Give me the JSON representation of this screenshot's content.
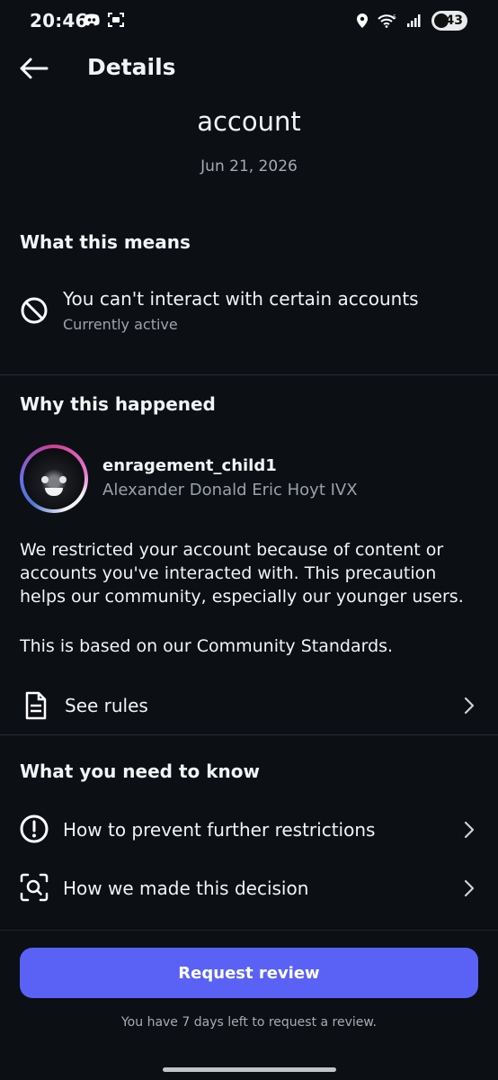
{
  "status_bar": {
    "time": "20:46",
    "battery_level": "43",
    "icons_left": [
      "discord-icon",
      "screenshot-icon"
    ],
    "icons_right": [
      "location-icon",
      "wifi-icon",
      "signal-icon",
      "battery-icon"
    ]
  },
  "header": {
    "title": "Details",
    "back_icon": "arrow-left-icon"
  },
  "hero": {
    "title_visible": "account",
    "date": "Jun 21, 2026"
  },
  "sections": {
    "what_this_means": {
      "heading": "What this means",
      "item_title": "You can't interact with certain accounts",
      "item_status": "Currently active",
      "icon": "block-icon"
    },
    "why_this_happened": {
      "heading": "Why this happened",
      "profile": {
        "username": "enragement_child1",
        "display_name": "Alexander Donald Eric Hoyt IVX"
      },
      "explanation": "We restricted your account because of content or accounts you've interacted with. This precaution helps our community, especially our younger users.",
      "standards_line": "This is based on our Community Standards.",
      "see_rules_label": "See rules"
    },
    "what_you_need_to_know": {
      "heading": "What you need to know",
      "items": [
        {
          "label": "How to prevent further restrictions",
          "icon": "alert-circle-icon"
        },
        {
          "label": "How we made this decision",
          "icon": "search-scan-icon"
        }
      ]
    }
  },
  "cta": {
    "label": "Request review",
    "note": "You have 7 days left to request a review."
  },
  "colors": {
    "background": "#0c0f14",
    "primary": "#5a62f5",
    "muted_text": "#9fa3aa",
    "divider": "#2a2e35"
  }
}
